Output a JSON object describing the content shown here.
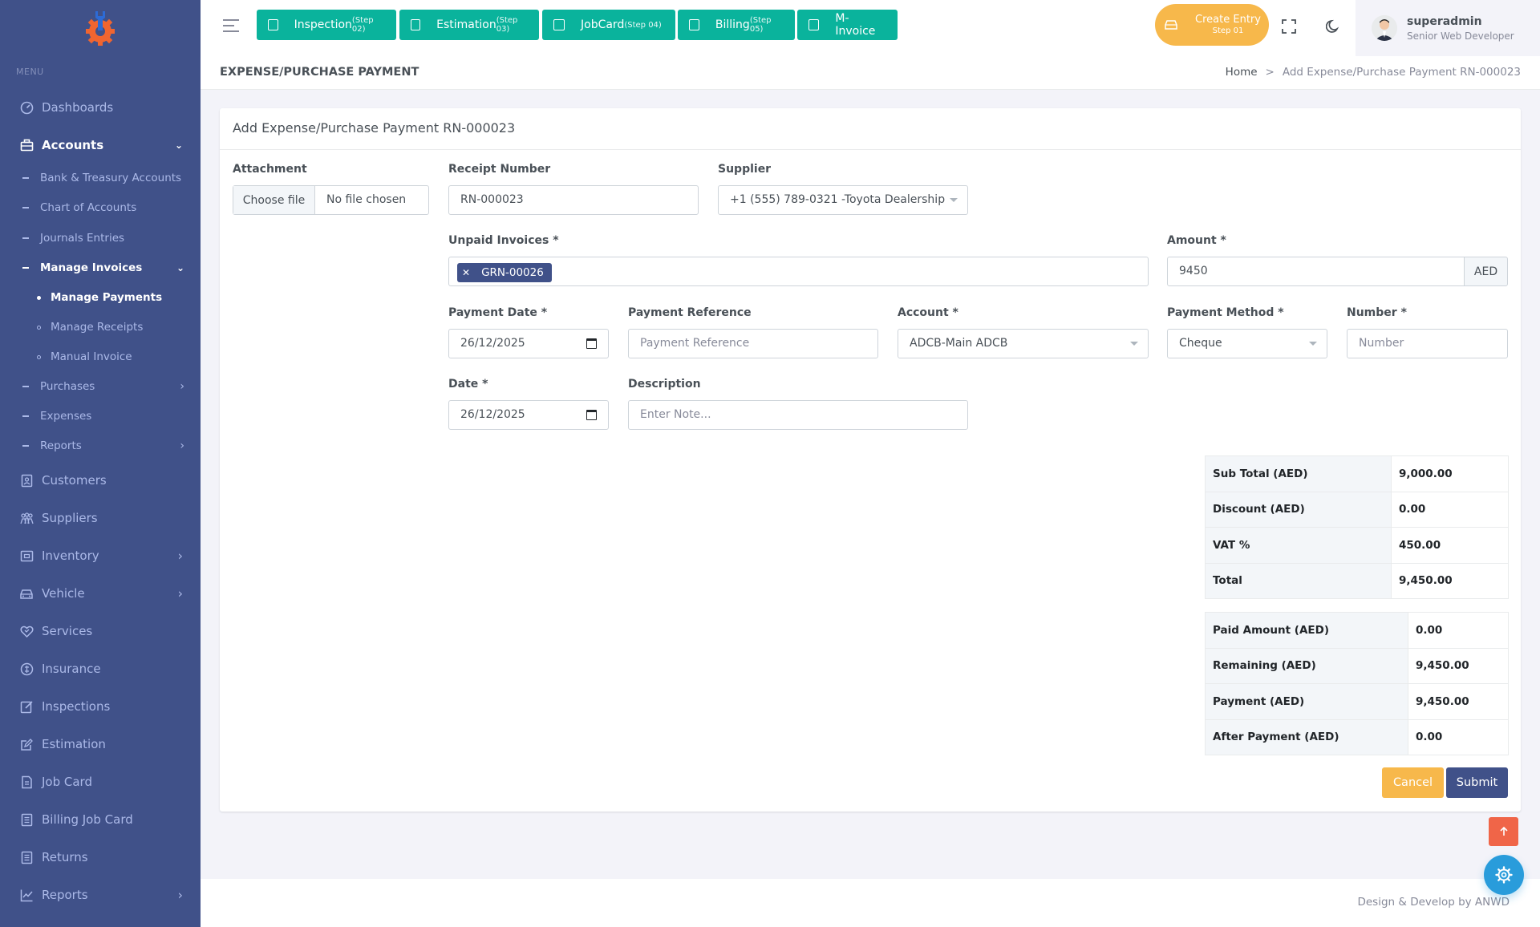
{
  "sidebar": {
    "menu_title": "Menu",
    "items": [
      {
        "label": "Dashboards",
        "icon": "dashboard-icon"
      },
      {
        "label": "Accounts",
        "icon": "briefcase-icon",
        "expanded": true
      },
      {
        "label": "Customers",
        "icon": "customers-icon"
      },
      {
        "label": "Suppliers",
        "icon": "suppliers-icon"
      },
      {
        "label": "Inventory",
        "icon": "inventory-icon"
      },
      {
        "label": "Vehicle",
        "icon": "car-icon"
      },
      {
        "label": "Services",
        "icon": "heart-handshake-icon"
      },
      {
        "label": "Insurance",
        "icon": "insurance-icon"
      },
      {
        "label": "Inspections",
        "icon": "edit-box-icon"
      },
      {
        "label": "Estimation",
        "icon": "edit-icon"
      },
      {
        "label": "Job Card",
        "icon": "file-icon"
      },
      {
        "label": "Billing Job Card",
        "icon": "file-list-icon"
      },
      {
        "label": "Returns",
        "icon": "file-list-icon"
      },
      {
        "label": "Reports",
        "icon": "line-chart-icon"
      }
    ],
    "accounts_sub": [
      {
        "label": "Bank & Treasury Accounts"
      },
      {
        "label": "Chart of Accounts"
      },
      {
        "label": "Journals Entries"
      },
      {
        "label": "Manage Invoices"
      },
      {
        "label": "Purchases"
      },
      {
        "label": "Expenses"
      },
      {
        "label": "Reports"
      }
    ],
    "invoices_sub": [
      {
        "label": "Manage Payments"
      },
      {
        "label": "Manage Receipts"
      },
      {
        "label": "Manual Invoice"
      }
    ]
  },
  "topbar": {
    "steps": [
      {
        "label": "Inspection",
        "step": "(Step 02)"
      },
      {
        "label": "Estimation",
        "step": "(Step 03)"
      },
      {
        "label": "JobCard",
        "step": "(Step 04)"
      },
      {
        "label": "Billing",
        "step": "(Step 05)"
      },
      {
        "label": "M-Invoice",
        "step": ""
      }
    ],
    "create_entry": {
      "label": "Create Entry",
      "step": "Step 01"
    },
    "user": {
      "name": "superadmin",
      "role": "Senior Web Developer"
    }
  },
  "page": {
    "title": "EXPENSE/PURCHASE PAYMENT",
    "breadcrumb_home": "Home",
    "breadcrumb_sep": ">",
    "breadcrumb_current": "Add Expense/Purchase Payment RN-000023"
  },
  "form": {
    "header": "Add Expense/Purchase Payment RN-000023",
    "attachment_label": "Attachment",
    "file_button": "Choose file",
    "file_status": "No file chosen",
    "receipt_label": "Receipt Number",
    "receipt_value": "RN-000023",
    "supplier_label": "Supplier",
    "supplier_value": "+1 (555) 789-0321 -Toyota Dealership",
    "unpaid_label": "Unpaid Invoices *",
    "unpaid_tag": "GRN-00026",
    "amount_label": "Amount *",
    "amount_value": "9450",
    "amount_currency": "AED",
    "payment_date_label": "Payment Date *",
    "payment_date_value": "26/12/2025",
    "payment_ref_label": "Payment Reference",
    "payment_ref_placeholder": "Payment Reference",
    "account_label": "Account *",
    "account_value": "ADCB-Main ADCB",
    "method_label": "Payment Method *",
    "method_value": "Cheque",
    "number_label": "Number *",
    "number_placeholder": "Number",
    "date_label": "Date *",
    "date_value": "26/12/2025",
    "description_label": "Description",
    "description_placeholder": "Enter Note..."
  },
  "totals": [
    {
      "label": "Sub Total (AED)",
      "value": "9,000.00"
    },
    {
      "label": "Discount (AED)",
      "value": "0.00"
    },
    {
      "label": "VAT %",
      "value": "450.00"
    },
    {
      "label": "Total",
      "value": "9,450.00"
    }
  ],
  "payments": [
    {
      "label": "Paid Amount (AED)",
      "value": "0.00"
    },
    {
      "label": "Remaining (AED)",
      "value": "9,450.00"
    },
    {
      "label": "Payment (AED)",
      "value": "9,450.00"
    },
    {
      "label": "After Payment (AED)",
      "value": "0.00"
    }
  ],
  "actions": {
    "cancel": "Cancel",
    "submit": "Submit"
  },
  "footer": {
    "text": "Design & Develop by ANWD"
  },
  "colors": {
    "sidebar": "#405189",
    "primary": "#405189",
    "success": "#0ab39c",
    "warning": "#f7b84b",
    "danger": "#f06548",
    "info": "#299cdb"
  }
}
